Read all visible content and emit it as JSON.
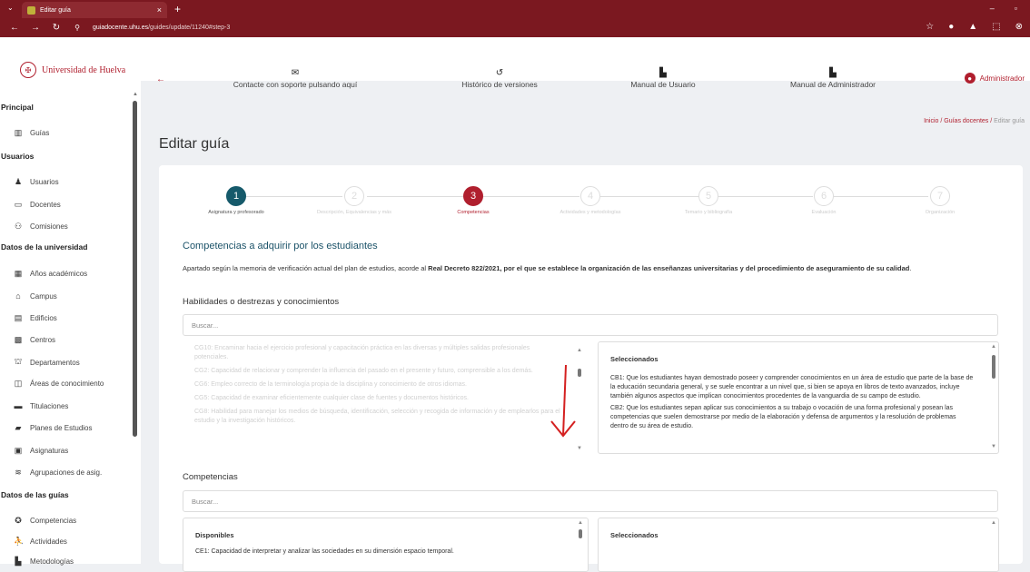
{
  "browser": {
    "tab_title": "Editar guía",
    "url_domain": "guiadocente.uhu.es",
    "url_path": "/guides/update/11240#step-3"
  },
  "sidebar": {
    "logo_text": "Universidad de Huelva",
    "sections": [
      {
        "title": "Principal",
        "items": [
          {
            "label": "Guías",
            "icon": "books-icon"
          }
        ]
      },
      {
        "title": "Usuarios",
        "items": [
          {
            "label": "Usuarios",
            "icon": "user-icon"
          },
          {
            "label": "Docentes",
            "icon": "teacher-icon"
          },
          {
            "label": "Comisiones",
            "icon": "group-icon"
          }
        ]
      },
      {
        "title": "Datos de la universidad",
        "items": [
          {
            "label": "Años académicos",
            "icon": "calendar-icon"
          },
          {
            "label": "Campus",
            "icon": "campus-icon"
          },
          {
            "label": "Edificios",
            "icon": "building-icon"
          },
          {
            "label": "Centros",
            "icon": "center-icon"
          },
          {
            "label": "Departamentos",
            "icon": "department-icon"
          },
          {
            "label": "Áreas de conocimiento",
            "icon": "area-icon"
          },
          {
            "label": "Titulaciones",
            "icon": "degree-icon"
          },
          {
            "label": "Planes de Estudios",
            "icon": "folder-icon"
          },
          {
            "label": "Asignaturas",
            "icon": "book-icon"
          },
          {
            "label": "Agrupaciones de asig.",
            "icon": "layers-icon"
          }
        ]
      },
      {
        "title": "Datos de las guías",
        "items": [
          {
            "label": "Competencias",
            "icon": "badge-icon"
          },
          {
            "label": "Actividades",
            "icon": "activity-icon"
          },
          {
            "label": "Metodologías",
            "icon": "method-icon"
          }
        ]
      }
    ]
  },
  "topbar": {
    "links": [
      {
        "label": "Contacte con soporte pulsando aquí",
        "icon": "envelope-icon"
      },
      {
        "label": "Histórico de versiones",
        "icon": "history-icon"
      },
      {
        "label": "Manual de Usuario",
        "icon": "manual-icon"
      },
      {
        "label": "Manual de Administrador",
        "icon": "manual-admin-icon"
      }
    ],
    "user": "Administrador"
  },
  "breadcrumb": {
    "home": "Inicio",
    "section": "Guías docentes",
    "current": "Editar guía"
  },
  "page_title": "Editar guía",
  "steps": [
    {
      "num": "1",
      "label": "Asignatura y profesorado",
      "state": "done"
    },
    {
      "num": "2",
      "label": "Descripción, Equivalencias y más",
      "state": "todo"
    },
    {
      "num": "3",
      "label": "Competencias",
      "state": "active"
    },
    {
      "num": "4",
      "label": "Actividades y metodologías",
      "state": "todo"
    },
    {
      "num": "5",
      "label": "Temario y bibliografía",
      "state": "todo"
    },
    {
      "num": "6",
      "label": "Evaluación",
      "state": "todo"
    },
    {
      "num": "7",
      "label": "Organización",
      "state": "todo"
    }
  ],
  "main": {
    "heading": "Competencias a adquirir por los estudiantes",
    "desc_pre": "Apartado según la memoria de verificación actual del plan de estudios, acorde al ",
    "desc_bold": "Real Decreto 822/2021, por el que se establece la organización de las enseñanzas universitarias y del procedimiento de aseguramiento de su calidad",
    "desc_post": ".",
    "skills_title": "Habilidades o destrezas y conocimientos",
    "search_placeholder": "Buscar...",
    "available_items": [
      "CG10: Encaminar hacia el ejercicio profesional y capacitación práctica en las diversas y múltiples salidas profesionales potenciales.",
      "CG2: Capacidad de relacionar y comprender la influencia del pasado en el presente y futuro, comprensible a los demás.",
      "CG6: Empleo correcto de la terminología propia de la disciplina y conocimiento de otros idiomas.",
      "CG5: Capacidad de examinar eficientemente cualquier clase de fuentes y documentos históricos.",
      "CG8: Habilidad para manejar los medios de búsqueda, identificación, selección y recogida de información y de emplearlos para el estudio y la investigación históricos."
    ],
    "selected_title": "Seleccionados",
    "selected_items": [
      "CB1: Que los estudiantes hayan demostrado poseer y comprender conocimientos en un área de estudio que parte de la base de la educación secundaria general, y se suele encontrar a un nivel que, si bien se apoya en libros de texto avanzados, incluye también algunos aspectos que implican conocimientos procedentes de la vanguardia de su campo de estudio.",
      "CB2: Que los estudiantes sepan aplicar sus conocimientos a su trabajo o vocación de una forma profesional y posean las competencias que suelen demostrarse por medio de la elaboración y defensa de argumentos y la resolución de problemas dentro de su área de estudio."
    ],
    "competencias_title": "Competencias",
    "available_title": "Disponibles",
    "competencias_available": [
      "CE1: Capacidad de interpretar y analizar las sociedades en su dimensión espacio temporal."
    ]
  },
  "colors": {
    "brand": "#b01f2e",
    "teal": "#165a6b",
    "annotation": "#d42020"
  }
}
